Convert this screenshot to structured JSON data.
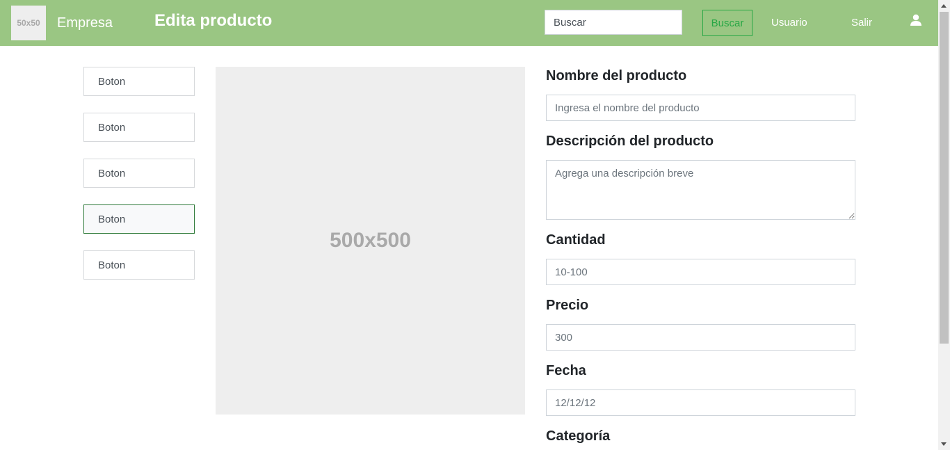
{
  "header": {
    "logo_text": "50x50",
    "brand": "Empresa",
    "title": "Edita producto",
    "search_placeholder": "Buscar",
    "search_button": "Buscar",
    "user_link": "Usuario",
    "logout_link": "Salir",
    "icon": "user-icon",
    "background_color": "#9ac683",
    "search_button_color": "#28a745"
  },
  "sidebar": {
    "buttons": [
      {
        "label": "Boton"
      },
      {
        "label": "Boton"
      },
      {
        "label": "Boton"
      },
      {
        "label": "Boton",
        "active": true
      },
      {
        "label": "Boton"
      }
    ]
  },
  "image": {
    "placeholder_text": "500x500"
  },
  "form": {
    "name_label": "Nombre del producto",
    "name_placeholder": "Ingresa el nombre del producto",
    "description_label": "Descripción del producto",
    "description_placeholder": "Agrega una descripción breve",
    "quantity_label": "Cantidad",
    "quantity_placeholder": "10-100",
    "price_label": "Precio",
    "price_placeholder": "300",
    "date_label": "Fecha",
    "date_placeholder": "12/12/12",
    "category_label": "Categoría"
  }
}
